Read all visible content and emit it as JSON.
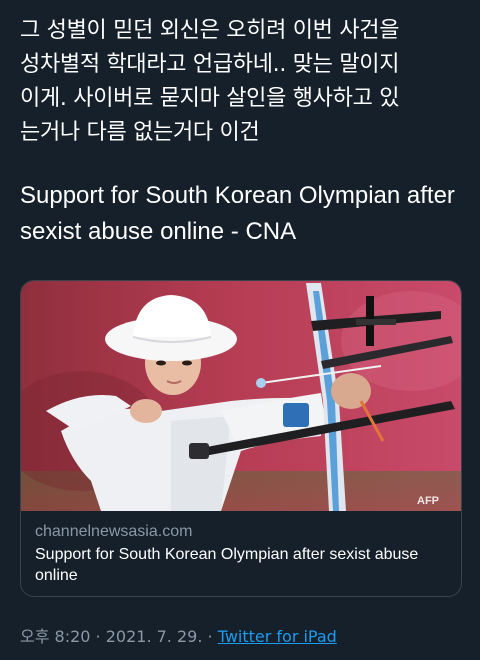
{
  "tweet": {
    "text": "그 성별이 믿던 외신은 오히려 이번 사건을\n성차별적 학대라고 언급하네.. 맞는 말이지\n이게. 사이버로 묻지마 살인을 행사하고 있\n는거나 다름 없는거다 이건",
    "quoted_title": "Support for South Korean Olympian after sexist abuse online - CNA"
  },
  "link_card": {
    "domain": "channelnewsasia.com",
    "title": "Support for South Korean Olympian after sexist abuse online",
    "image_watermark": "AFP"
  },
  "meta": {
    "time": "오후 8:20",
    "separator": " · ",
    "date": "2021. 7. 29.",
    "source": "Twitter for iPad"
  },
  "colors": {
    "background": "#15202b",
    "text": "#ffffff",
    "secondary_text": "#8b98a5",
    "link": "#1d9bf0",
    "card_border": "#38444d"
  }
}
